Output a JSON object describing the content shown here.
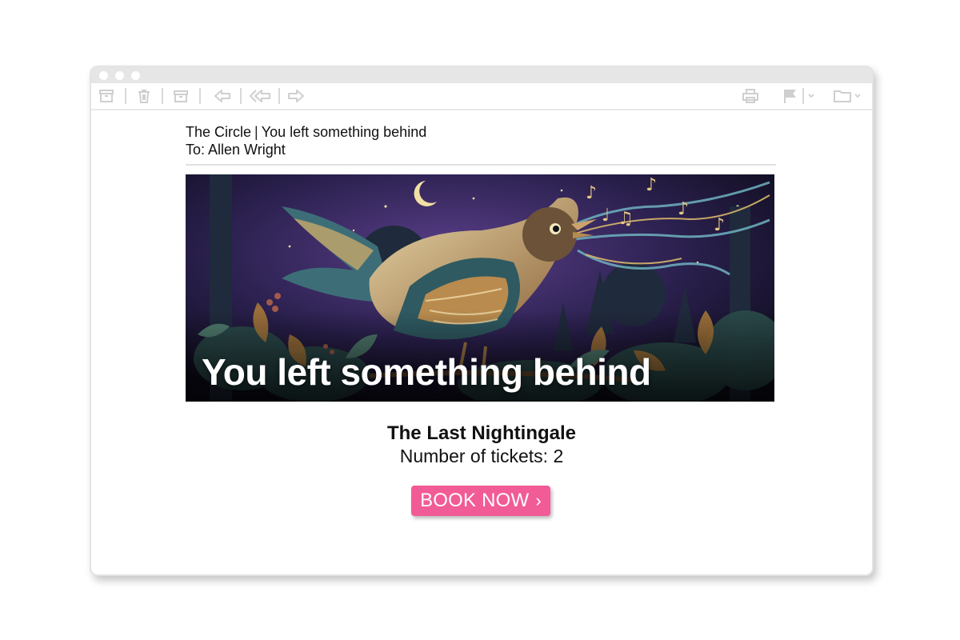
{
  "email": {
    "sender": "The Circle",
    "separator": "|",
    "subject": "You left something behind",
    "to_line": "To: Allen Wright"
  },
  "toolbar": {
    "icons": [
      "archive-icon",
      "trash-icon",
      "archive-box-icon",
      "reply-icon",
      "reply-all-icon",
      "forward-icon",
      "print-icon",
      "flag-icon",
      "folder-icon"
    ]
  },
  "banner": {
    "headline": "You left something behind"
  },
  "event": {
    "name": "The Last Nightingale",
    "tickets": "Number of tickets: 2"
  },
  "cta": {
    "label": "BOOK NOW",
    "chevron": "›",
    "color": "#f15b96"
  }
}
